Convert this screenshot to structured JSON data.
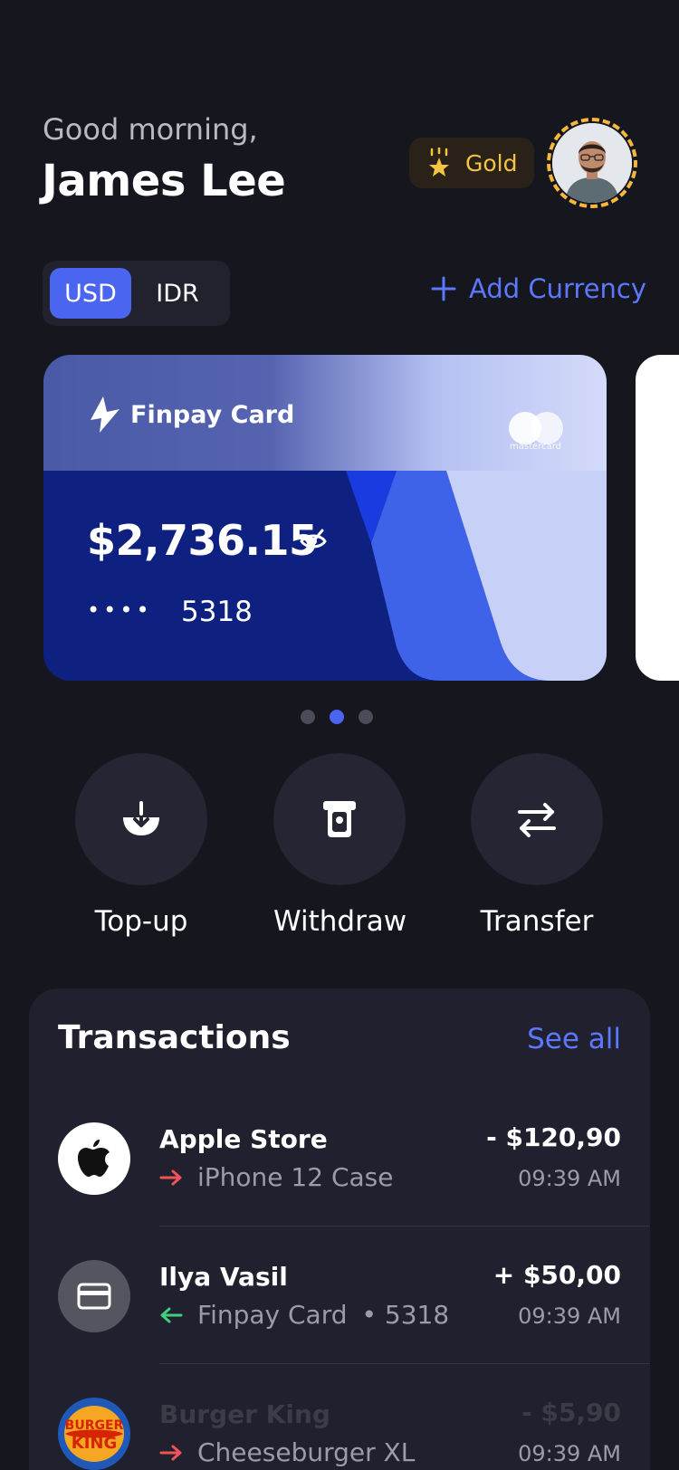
{
  "header": {
    "greeting": "Good morning,",
    "user_name": "James Lee",
    "tier": "Gold"
  },
  "currency": {
    "tabs": [
      "USD",
      "IDR"
    ],
    "active": "USD",
    "add_label": "Add Currency"
  },
  "card": {
    "brand": "Finpay Card",
    "network": "mastercard",
    "balance": "$2,736.15",
    "masked": "••••",
    "last4": "5318"
  },
  "pager": {
    "count": 3,
    "active_index": 1
  },
  "actions": [
    {
      "label": "Top-up",
      "icon": "top-up-icon"
    },
    {
      "label": "Withdraw",
      "icon": "withdraw-icon"
    },
    {
      "label": "Transfer",
      "icon": "transfer-icon"
    }
  ],
  "transactions": {
    "title": "Transactions",
    "see_all": "See all",
    "items": [
      {
        "name": "Apple Store",
        "detail": "iPhone 12 Case",
        "detail_suffix": "",
        "amount": "- $120,90",
        "time": "09:39 AM",
        "direction": "out",
        "icon": "apple-icon"
      },
      {
        "name": "Ilya Vasil",
        "detail": "Finpay Card",
        "detail_suffix": "• 5318",
        "amount": "+ $50,00",
        "time": "09:39 AM",
        "direction": "in",
        "icon": "card-icon"
      },
      {
        "name": "Burger King",
        "detail": "Cheeseburger XL",
        "detail_suffix": "",
        "amount": "- $5,90",
        "time": "09:39 AM",
        "direction": "out",
        "icon": "burger-king-logo",
        "logo_text": "BURGER KING"
      }
    ]
  },
  "colors": {
    "background": "#16161f",
    "accent": "#4a65f0",
    "gold": "#f5c542",
    "outgoing": "#f05454",
    "incoming": "#3ed17a"
  }
}
